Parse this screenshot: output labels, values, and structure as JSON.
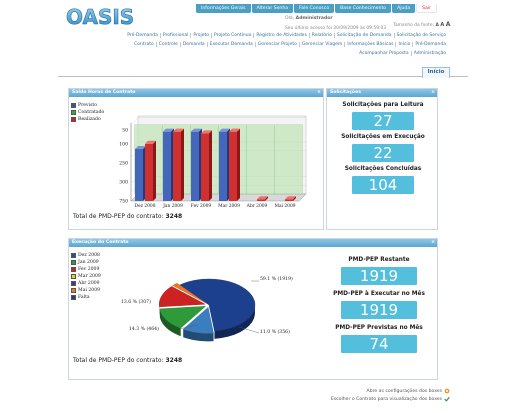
{
  "app": {
    "logo_text": "OASIS",
    "top_menu": [
      "Informações Gerais",
      "Alterar Senha",
      "Fale Conosco",
      "Base Conhecimento",
      "Ajuda",
      "Sair"
    ],
    "welcome_prefix": "Olá, ",
    "user": "Administrador",
    "last_access": "Seu último acesso foi 30/09/2009 às 09:59:03",
    "font_size_label": "Tamanho da fonte:",
    "font_sizes": [
      "A",
      "A",
      "A"
    ]
  },
  "nav": {
    "row1": [
      "Pré-Demanda",
      "Profissional",
      "Projeto",
      "Projeto Contínuo",
      "Registro de Atividades",
      "Relatório",
      "Solicitação de Demanda",
      "Solicitação de Serviço"
    ],
    "row2": [
      "Contrato",
      "Controle",
      "Demanda",
      "Executar Demanda",
      "Gerenciar Projeto",
      "Gerenciar Viagem",
      "Informações Básicas",
      "Início",
      "Pré-Demanda"
    ],
    "row3": [
      "Acompanhar Proposta",
      "Administração"
    ],
    "active_tab": "Início"
  },
  "panel_horas": {
    "title": "Saldo Horas de Contrato",
    "close": "×",
    "total_label": "Total de PMD-PEP do contrato:",
    "total_value": "3248"
  },
  "panel_solic": {
    "title": "Solicitações",
    "close": "×",
    "items": [
      {
        "label": "Solicitações para Leitura",
        "value": "27"
      },
      {
        "label": "Solicitações em Execução",
        "value": "22"
      },
      {
        "label": "Solicitações Concluídas",
        "value": "104"
      }
    ]
  },
  "panel_exec": {
    "title": "Execução do Contrato",
    "close": "×",
    "total_label": "Total de PMD-PEP do contrato:",
    "total_value": "3248",
    "items": [
      {
        "label": "PMD-PEP Restante",
        "value": "1919"
      },
      {
        "label": "PMD-PEP à Executar no Mês",
        "value": "1919"
      },
      {
        "label": "PMD-PEP Previstas no Mês",
        "value": "74"
      }
    ]
  },
  "footer": {
    "config_text": "Abre as configurações dos boxes",
    "contract_text": "Escolher o Contrato para visualização dos boxes"
  },
  "chart_data": [
    {
      "type": "bar",
      "categories": [
        "Dez 2008",
        "Jan 2009",
        "Fev 2009",
        "Mar 2009",
        "Abr 2009",
        "Mai 2009"
      ],
      "series": [
        {
          "name": "Previsto",
          "color": "#3355aa",
          "values": [
            300,
            400,
            400,
            400,
            0,
            0
          ]
        },
        {
          "name": "Contratado",
          "color": "#33aa44",
          "values": [
            400,
            400,
            400,
            400,
            400,
            400
          ]
        },
        {
          "name": "Realizado",
          "color": "#cc2222",
          "values": [
            330,
            400,
            390,
            400,
            10,
            10
          ]
        }
      ],
      "y_ticks": [
        50,
        100,
        250,
        300,
        750
      ],
      "ylim": [
        0,
        450
      ]
    },
    {
      "type": "pie",
      "legend": [
        {
          "name": "Dez 2008",
          "color": "#2a4d9c"
        },
        {
          "name": "Jan 2009",
          "color": "#2f9a3a"
        },
        {
          "name": "Fev 2009",
          "color": "#cc2222"
        },
        {
          "name": "Mar 2009",
          "color": "#e8d020"
        },
        {
          "name": "Abr 2009",
          "color": "#5a2d8c"
        },
        {
          "name": "Mai 2009",
          "color": "#ee7722"
        },
        {
          "name": "Falta",
          "color": "#1c3f8e"
        }
      ],
      "slices": [
        {
          "label": "59.1 % (1919)",
          "value": 59.1,
          "color": "#1c3f8e"
        },
        {
          "label": "11.0 % (356)",
          "value": 11.0,
          "color": "#3a7ec0"
        },
        {
          "label": "14.3 % (464)",
          "value": 14.3,
          "color": "#2f9a3a"
        },
        {
          "label": "13.6 % (307)",
          "value": 13.6,
          "color": "#cc2222"
        },
        {
          "label": "",
          "value": 2.0,
          "color": "#ee7722"
        }
      ]
    }
  ]
}
